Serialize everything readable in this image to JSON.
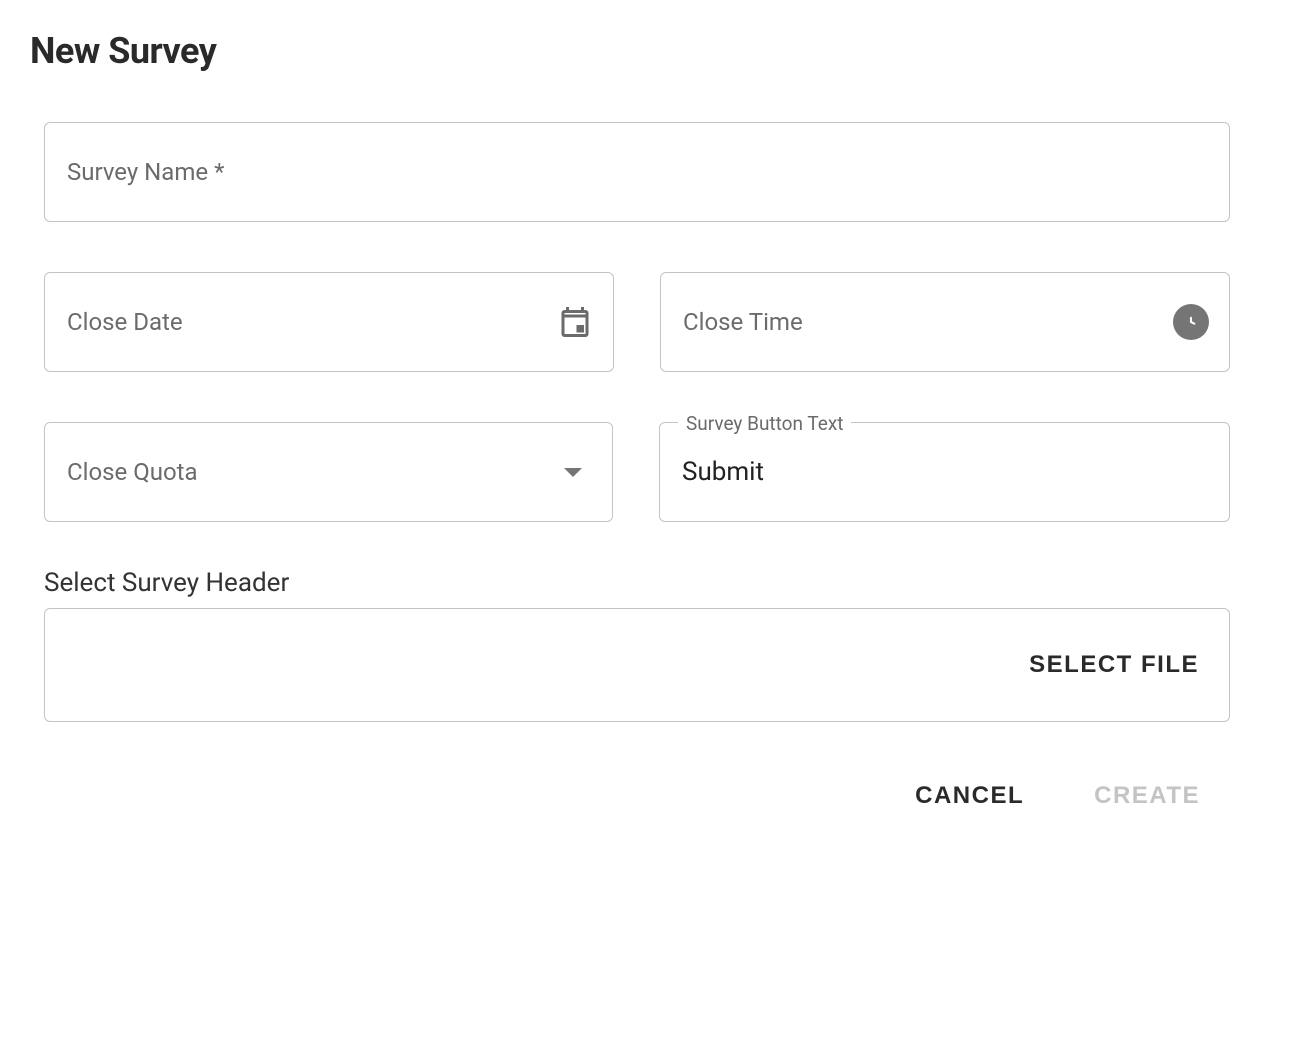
{
  "title": "New Survey",
  "fields": {
    "survey_name": {
      "placeholder": "Survey Name *",
      "value": ""
    },
    "close_date": {
      "placeholder": "Close Date",
      "value": ""
    },
    "close_time": {
      "placeholder": "Close Time",
      "value": ""
    },
    "close_quota": {
      "placeholder": "Close Quota",
      "value": ""
    },
    "button_text": {
      "label": "Survey Button Text",
      "value": "Submit"
    }
  },
  "header_section": {
    "label": "Select Survey Header",
    "select_file_label": "SELECT FILE"
  },
  "actions": {
    "cancel": "CANCEL",
    "create": "CREATE"
  }
}
